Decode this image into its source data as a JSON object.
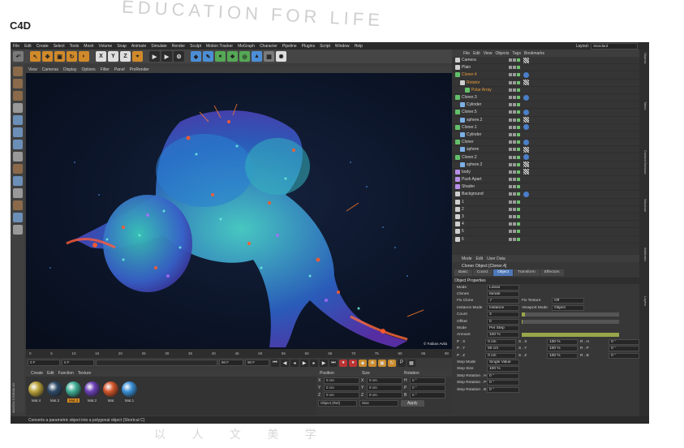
{
  "page_label": "C4D",
  "watermark": "EDUCATION FOR LIFE",
  "watermark_bottom": "以 人 文 美 学",
  "menubar": [
    "File",
    "Edit",
    "Create",
    "Select",
    "Tools",
    "Mesh",
    "Volume",
    "Snap",
    "Animate",
    "Simulate",
    "Render",
    "Sculpt",
    "Motion Tracker",
    "MoGraph",
    "Character",
    "Pipeline",
    "Plugins",
    "Script",
    "Window",
    "Help"
  ],
  "layout": {
    "label": "Layout:",
    "value": "Standard"
  },
  "viewport_menu": [
    "View",
    "Cameras",
    "Display",
    "Options",
    "Filter",
    "Panel",
    "ProRender"
  ],
  "viewport_credit": "© Fabian Avila",
  "timeline_ticks": [
    "0",
    "5",
    "10",
    "15",
    "20",
    "25",
    "30",
    "35",
    "40",
    "45",
    "50",
    "55",
    "60",
    "65",
    "70",
    "75",
    "80",
    "85",
    "90"
  ],
  "timeline_frame": "0 F",
  "transport": {
    "start": "0 F",
    "end": "90 F",
    "current": "0 F",
    "max": "90 F"
  },
  "material_menu": [
    "Create",
    "Edit",
    "Function",
    "Texture"
  ],
  "materials": [
    {
      "label": "Mat.4",
      "color": "#b9a23a"
    },
    {
      "label": "Mat.3",
      "color": "#2f4a68"
    },
    {
      "label": "Mat.3",
      "color": "#3fae94",
      "selected": true
    },
    {
      "label": "Mat.2",
      "color": "#6a3fb4"
    },
    {
      "label": "Mat",
      "color": "#d2552a"
    },
    {
      "label": "Mat.1",
      "color": "#3b8fd6"
    }
  ],
  "coords": {
    "headers": [
      "Position",
      "Size",
      "Rotation"
    ],
    "rows": [
      {
        "axis": "X",
        "pos": "0 cm",
        "size": "0 cm",
        "rot_axis": "H",
        "rot": "0 °"
      },
      {
        "axis": "Y",
        "pos": "0 cm",
        "size": "0 cm",
        "rot_axis": "P",
        "rot": "0 °"
      },
      {
        "axis": "Z",
        "pos": "0 cm",
        "size": "0 cm",
        "rot_axis": "B",
        "rot": "0 °"
      }
    ],
    "mode": "Object (Rel)",
    "size_mode": "Size",
    "apply": "Apply"
  },
  "status": "Converts a parametric object into a polygonal object (Shortcut C)",
  "maxon": "MAXON CINEMA 4D",
  "object_manager": {
    "menu": [
      "File",
      "Edit",
      "View",
      "Objects",
      "Tags",
      "Bookmarks"
    ],
    "rows": [
      {
        "name": "Camera",
        "icon": "w",
        "tag": "chk",
        "indent": 0
      },
      {
        "name": "Plain",
        "icon": "w",
        "tag": "",
        "indent": 0
      },
      {
        "name": "Cloner.4",
        "icon": "g",
        "tag": "ball",
        "indent": 0,
        "hl": true
      },
      {
        "name": "Rotator",
        "icon": "w",
        "tag": "chk",
        "indent": 1,
        "hl": true
      },
      {
        "name": "Polar Array",
        "icon": "g",
        "tag": "",
        "indent": 2,
        "hl": true
      },
      {
        "name": "Cloner.3",
        "icon": "g",
        "tag": "ball",
        "indent": 0
      },
      {
        "name": "Cylinder",
        "icon": "b",
        "tag": "",
        "indent": 1
      },
      {
        "name": "Cloner.5",
        "icon": "g",
        "tag": "ball",
        "indent": 0
      },
      {
        "name": "sphere.2",
        "icon": "b",
        "tag": "chk",
        "indent": 1
      },
      {
        "name": "Cloner.1",
        "icon": "g",
        "tag": "ball",
        "indent": 0
      },
      {
        "name": "Cylinder",
        "icon": "b",
        "tag": "",
        "indent": 1
      },
      {
        "name": "Cloner",
        "icon": "g",
        "tag": "ball",
        "indent": 0
      },
      {
        "name": "sphere",
        "icon": "b",
        "tag": "chk",
        "indent": 1
      },
      {
        "name": "Cloner.2",
        "icon": "g",
        "tag": "ball",
        "indent": 0
      },
      {
        "name": "sphere.2",
        "icon": "b",
        "tag": "chk",
        "indent": 1
      },
      {
        "name": "body",
        "icon": "p",
        "tag": "chk",
        "indent": 0
      },
      {
        "name": "Push Apart",
        "icon": "p",
        "tag": "",
        "indent": 0
      },
      {
        "name": "Shader",
        "icon": "p",
        "tag": "",
        "indent": 0
      },
      {
        "name": "Background",
        "icon": "w",
        "tag": "ball",
        "indent": 0
      },
      {
        "name": "1",
        "icon": "w",
        "tag": "",
        "indent": 0
      },
      {
        "name": "2",
        "icon": "w",
        "tag": "",
        "indent": 0
      },
      {
        "name": "3",
        "icon": "w",
        "tag": "",
        "indent": 0
      },
      {
        "name": "4",
        "icon": "w",
        "tag": "",
        "indent": 0
      },
      {
        "name": "5",
        "icon": "w",
        "tag": "",
        "indent": 0
      },
      {
        "name": "6",
        "icon": "w",
        "tag": "",
        "indent": 0
      }
    ]
  },
  "attributes": {
    "menu": [
      "Mode",
      "Edit",
      "User Data"
    ],
    "title": "Cloner Object [Cloner.4]",
    "tabs": [
      "Basic",
      "Coord.",
      "Object",
      "Transform",
      "Effectors"
    ],
    "active_tab": "Object",
    "section": "Object Properties",
    "rows": [
      {
        "label": "Mode",
        "value": "Linear"
      },
      {
        "label": "Clones",
        "value": "Iterate"
      },
      {
        "label": "Fix Clone",
        "value": "✓"
      },
      {
        "label": "Instance Mode",
        "value": "Instance"
      },
      {
        "label": "Count",
        "value": "3"
      },
      {
        "label": "Offset",
        "value": "0"
      },
      {
        "label": "Mode",
        "value": "Per Step"
      },
      {
        "label": "Amount",
        "value": "100 %"
      },
      {
        "label": "P . X",
        "value": "0 cm"
      },
      {
        "label": "P . Y",
        "value": "50 cm"
      },
      {
        "label": "P . Z",
        "value": "0 cm"
      },
      {
        "label": "Step Mode",
        "value": "Single Value"
      },
      {
        "label": "Step Size",
        "value": "100 %"
      },
      {
        "label": "Step Rotation . H",
        "value": "0 °"
      },
      {
        "label": "Step Rotation . P",
        "value": "0 °"
      },
      {
        "label": "Step Rotation . B",
        "value": "0 °"
      }
    ],
    "fix_texture": {
      "label": "Fix Texture",
      "value": "Off"
    },
    "viewport_mode": {
      "label": "Viewport Mode",
      "value": "Object"
    },
    "scale": [
      {
        "label": "S . X",
        "value": "100 %"
      },
      {
        "label": "S . Y",
        "value": "100 %"
      },
      {
        "label": "S . Z",
        "value": "100 %"
      }
    ],
    "rot": [
      {
        "label": "R . H",
        "value": "0 °"
      },
      {
        "label": "R . P",
        "value": "0 °"
      },
      {
        "label": "R . B",
        "value": "0 °"
      }
    ]
  },
  "right_tabs": [
    "Objects",
    "Takes",
    "Content Browser",
    "Structure",
    "Attributes",
    "Layers"
  ]
}
